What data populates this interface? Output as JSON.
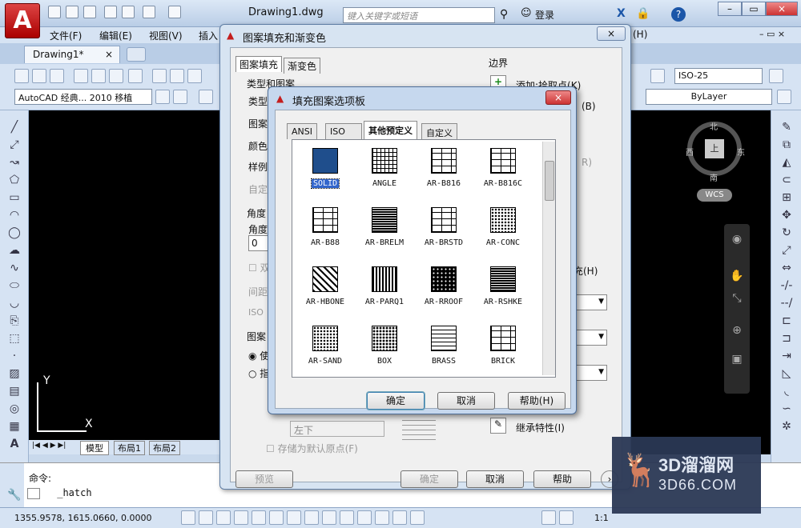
{
  "app": {
    "doc_title": "Drawing1.dwg",
    "search_placeholder": "键入关键字或短语",
    "login": "登录",
    "help_symbol": "?",
    "logo_letter": "A"
  },
  "menu": [
    "文件(F)",
    "编辑(E)",
    "视图(V)",
    "插入",
    "(H)"
  ],
  "doc_tab": {
    "label": "Drawing1*",
    "close": "×"
  },
  "toolbar": {
    "workspace": "AutoCAD 经典... 2010 移植",
    "dimstyle": "ISO-25",
    "linetype": "ByLayer"
  },
  "viewcube": {
    "north": "北",
    "south": "南",
    "west": "西",
    "east": "东",
    "face": "上",
    "wcs": "WCS"
  },
  "layout_tabs": [
    "模型",
    "布局1",
    "布局2"
  ],
  "command": {
    "label": "命令:",
    "input": "_hatch"
  },
  "status": {
    "coords": "1355.9578, 1615.0660, 0.0000",
    "scale": "1:1"
  },
  "hatch_dialog": {
    "title": "图案填充和渐变色",
    "tabs": [
      "图案填充",
      "渐变色"
    ],
    "section_type": "类型和图案",
    "type_label": "类型",
    "pattern_label": "图案",
    "color_label": "颜色",
    "sample_label": "样例",
    "custom_label": "自定",
    "angle_section": "角度",
    "angle_label": "角度",
    "angle_value": "0",
    "double_label": "双",
    "spacing_label": "间距",
    "iso_label": "ISO",
    "origin_section": "图案",
    "origin_opt1": "使",
    "origin_opt2": "指",
    "bottom_left": "左下",
    "store_default": "存储为默认原点(F)",
    "boundary_section": "边界",
    "add_pick": "添加:拾取点(K)",
    "add_select_suffix": "(B)",
    "remove_suffix": "R)",
    "fill_suffix": "充(H)",
    "inherit": "继承特性(I)",
    "btn_preview": "预览",
    "btn_ok": "确定",
    "btn_cancel": "取消",
    "btn_help": "帮助",
    "close": "×"
  },
  "palette_dialog": {
    "title": "填充图案选项板",
    "close": "×",
    "tabs": [
      "ANSI",
      "ISO",
      "其他预定义",
      "自定义"
    ],
    "active_tab": 2,
    "patterns": [
      "SOLID",
      "ANGLE",
      "AR-B816",
      "AR-B816C",
      "AR-B88",
      "AR-BRELM",
      "AR-BRSTD",
      "AR-CONC",
      "AR-HBONE",
      "AR-PARQ1",
      "AR-RROOF",
      "AR-RSHKE",
      "AR-SAND",
      "BOX",
      "BRASS",
      "BRICK"
    ],
    "selected": "SOLID",
    "btn_ok": "确定",
    "btn_cancel": "取消",
    "btn_help": "帮助(H)"
  },
  "watermark": {
    "brand": "3D溜溜网",
    "url": "3D66.COM"
  },
  "colors": {
    "solid_swatch": "#1f4e8c",
    "autocad_red": "#c41e1e",
    "canvas": "#000000"
  }
}
